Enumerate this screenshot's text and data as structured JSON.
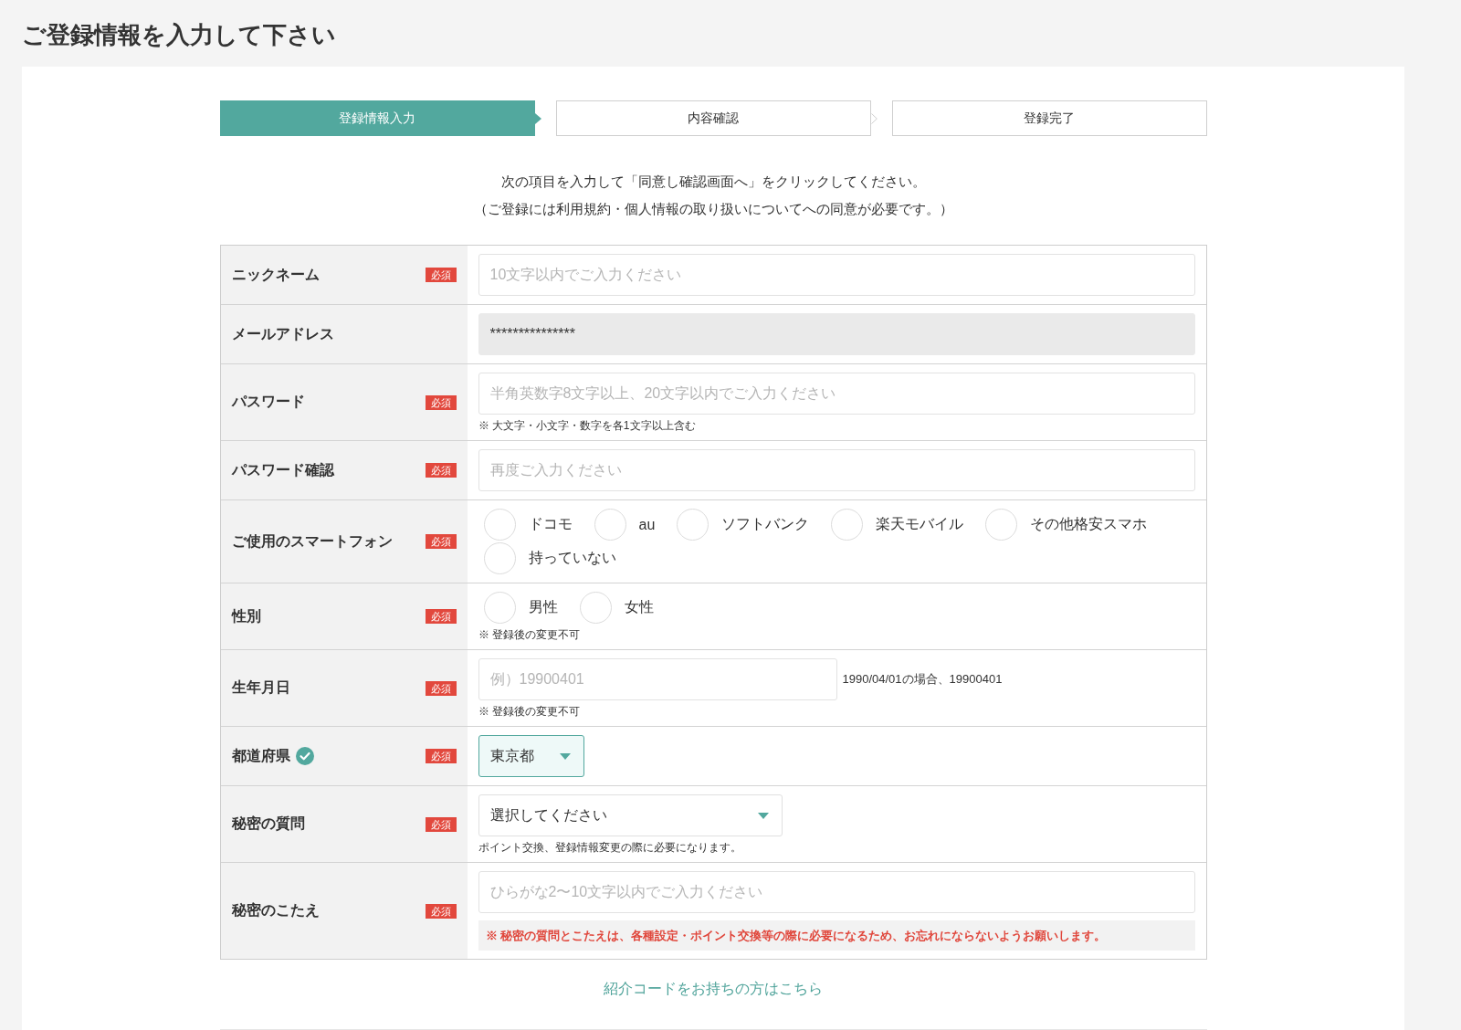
{
  "page": {
    "title": "ご登録情報を入力して下さい"
  },
  "steps": [
    {
      "label": "登録情報入力",
      "selected": true
    },
    {
      "label": "内容確認",
      "selected": false
    },
    {
      "label": "登録完了",
      "selected": false
    }
  ],
  "intro": [
    "次の項目を入力して「同意し確認画面へ」をクリックしてください。",
    "（ご登録には利用規約・個人情報の取り扱いについてへの同意が必要です。）"
  ],
  "form": {
    "rows": [
      {
        "kind": "text",
        "label": "ニックネーム",
        "badge": "必須",
        "placeholder": "10文字以内でご入力ください"
      },
      {
        "kind": "text",
        "label": "メールアドレス",
        "value": "***************",
        "disabled": true
      },
      {
        "kind": "text",
        "label": "パスワード",
        "badge": "必須",
        "placeholder": "半角英数字8文字以上、20文字以内でご入力ください",
        "note": "※ 大文字・小文字・数字を各1文字以上含む"
      },
      {
        "kind": "text",
        "label": "パスワード確認",
        "badge": "必須",
        "placeholder": "再度ご入力ください"
      },
      {
        "kind": "radio",
        "label": "ご使用のスマートフォン",
        "badge": "必須",
        "options": [
          {
            "label": "ドコモ",
            "selected": false
          },
          {
            "label": "au",
            "selected": false
          },
          {
            "label": "ソフトバンク",
            "selected": false
          },
          {
            "label": "楽天モバイル",
            "selected": false
          },
          {
            "label": "その他格安スマホ",
            "selected": false
          },
          {
            "label": "持っていない",
            "selected": false
          }
        ]
      },
      {
        "kind": "radio",
        "label": "性別",
        "badge": "必須",
        "options": [
          {
            "label": "男性",
            "selected": false
          },
          {
            "label": "女性",
            "selected": false
          }
        ],
        "note": "※ 登録後の変更不可"
      },
      {
        "kind": "text",
        "label": "生年月日",
        "badge": "必須",
        "placeholder": "例）19900401",
        "hint": "1990/04/01の場合、19900401",
        "note": "※ 登録後の変更不可"
      },
      {
        "kind": "shortselect",
        "label": "都道府県",
        "badge": "必須",
        "verified": true,
        "value": "東京都"
      },
      {
        "kind": "select",
        "label": "秘密の質問",
        "badge": "必須",
        "verified": false,
        "value": "選択してください",
        "note": "ポイント交換、登録情報変更の際に必要になります。"
      },
      {
        "kind": "text",
        "label": "秘密のこたえ",
        "badge": "必須",
        "placeholder": "ひらがな2〜10文字以内でご入力ください",
        "warning": "※ 秘密の質問とこたえは、各種設定・ポイント交換等の際に必要になるため、お忘れにならないようお願いします。"
      }
    ]
  },
  "referral_link": "紹介コードをお持ちの方はこちら"
}
